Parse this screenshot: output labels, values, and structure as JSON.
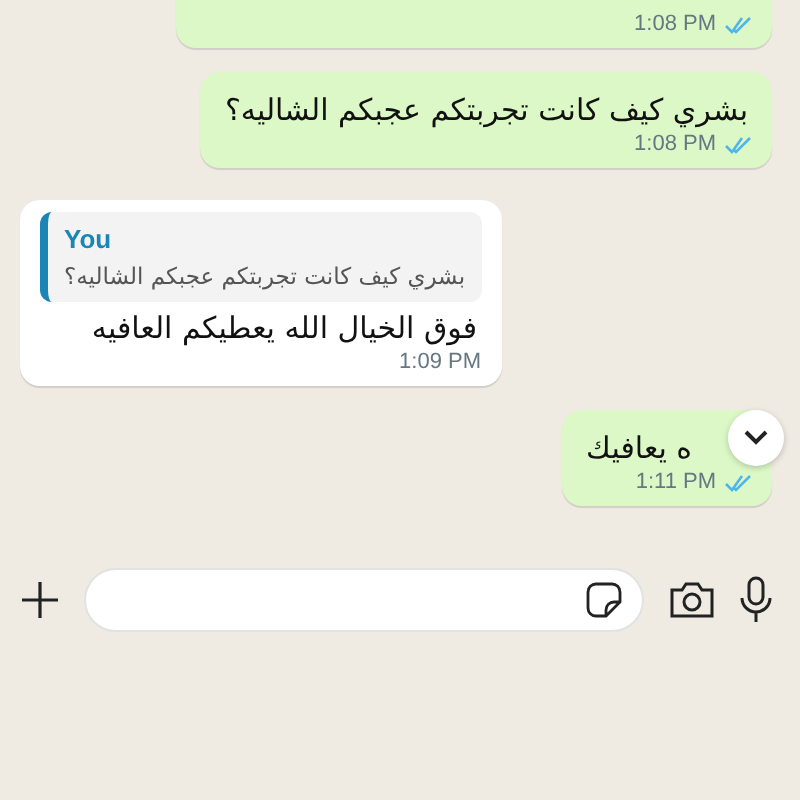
{
  "messages": [
    {
      "kind": "outgoing",
      "time": "1:08 PM",
      "read": true
    },
    {
      "kind": "outgoing",
      "text": "بشري كيف كانت تجربتكم عجبكم الشاليه؟",
      "time": "1:08 PM",
      "read": true
    },
    {
      "kind": "incoming",
      "reply": {
        "author": "You",
        "text": "بشري كيف كانت تجربتكم عجبكم الشاليه؟"
      },
      "text": "فوق الخيال الله يعطيكم العافيه",
      "time": "1:09 PM"
    },
    {
      "kind": "outgoing",
      "text": "ه يعافيك",
      "time": "1:11 PM",
      "read": true
    }
  ]
}
